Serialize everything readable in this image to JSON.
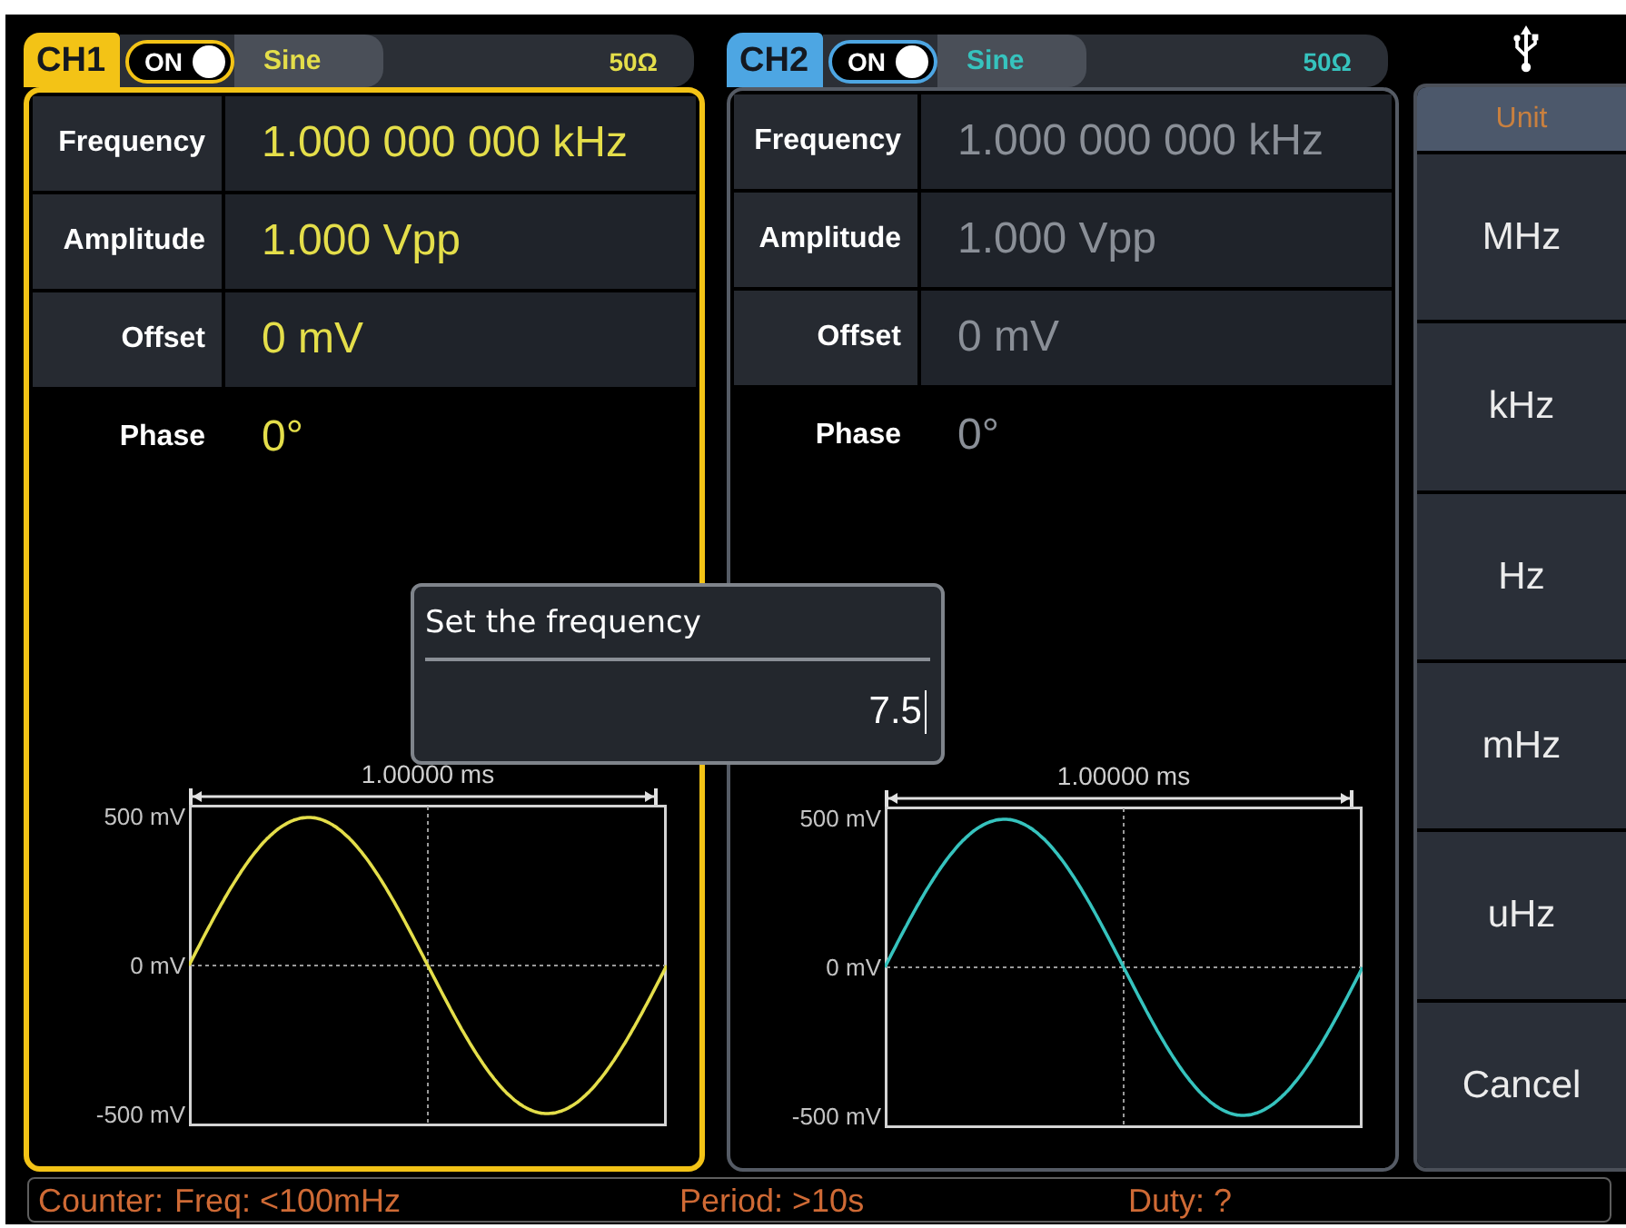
{
  "channels": [
    {
      "name": "CH1",
      "color": "#f3c316",
      "trace": {
        "color": "#e4de4a"
      },
      "selected": true,
      "output": {
        "label": "ON",
        "on": true
      },
      "waveform": "Sine",
      "load": "50Ω",
      "params": [
        {
          "label": "Frequency",
          "value": "1.000 000 000 kHz",
          "shaded": true
        },
        {
          "label": "Amplitude",
          "value": "1.000 Vpp",
          "shaded": true
        },
        {
          "label": "Offset",
          "value": "0 mV",
          "shaded": true
        },
        {
          "label": "Phase",
          "value": "0°",
          "shaded": false
        }
      ],
      "preview": {
        "time_span": "1.00000 ms",
        "y_labels": [
          "500 mV",
          "0 mV",
          "-500 mV"
        ]
      }
    },
    {
      "name": "CH2",
      "color": "#4da6e3",
      "trace": {
        "color": "#36c3be"
      },
      "selected": false,
      "output": {
        "label": "ON",
        "on": true
      },
      "waveform": "Sine",
      "load": "50Ω",
      "params": [
        {
          "label": "Frequency",
          "value": "1.000 000 000 kHz",
          "shaded": true
        },
        {
          "label": "Amplitude",
          "value": "1.000 Vpp",
          "shaded": true
        },
        {
          "label": "Offset",
          "value": "0 mV",
          "shaded": true
        },
        {
          "label": "Phase",
          "value": "0°",
          "shaded": false
        }
      ],
      "preview": {
        "time_span": "1.00000 ms",
        "y_labels": [
          "500 mV",
          "0 mV",
          "-500 mV"
        ]
      }
    }
  ],
  "dialog": {
    "title": "Set the frequency",
    "value": "7.5"
  },
  "menu": {
    "title": "Unit",
    "items": [
      "MHz",
      "kHz",
      "Hz",
      "mHz",
      "uHz",
      "Cancel"
    ]
  },
  "status_bar": {
    "label": "Counter:",
    "items": [
      "Freq: <100mHz",
      "Period: >10s",
      "Duty: ?"
    ]
  }
}
